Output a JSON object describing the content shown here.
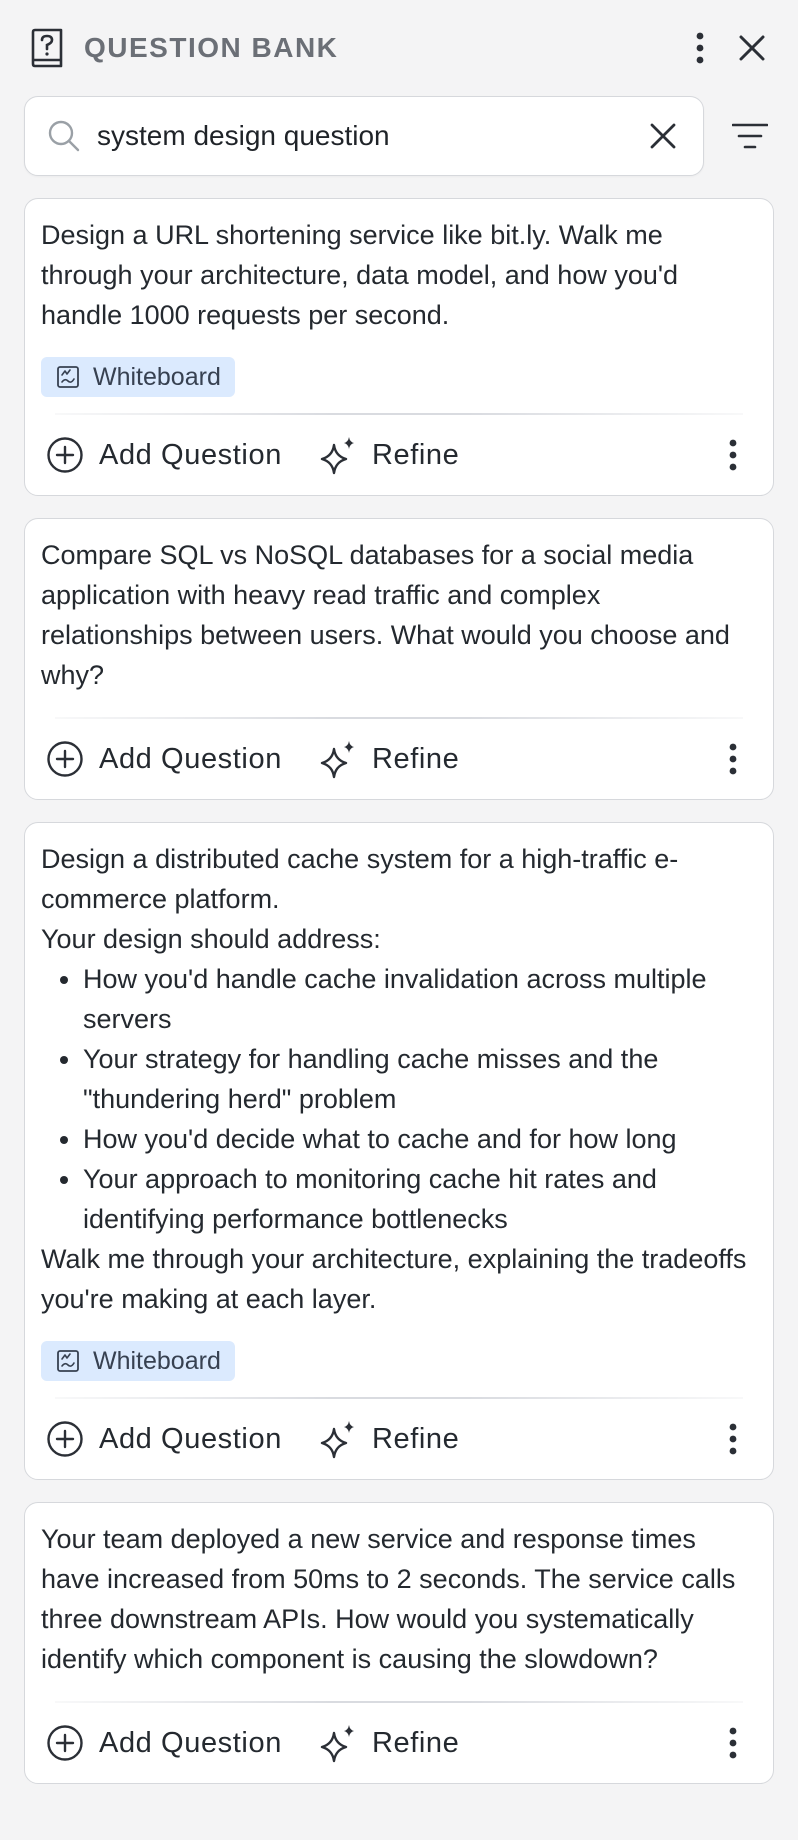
{
  "header": {
    "title": "QUESTION BANK"
  },
  "search": {
    "value": "system design question"
  },
  "cards": [
    {
      "intro": "Design a URL shortening service like bit.ly. Walk me through your architecture, data model, and how you'd handle 1000 requests per second.",
      "bullets": [],
      "outro": "",
      "tag": "Whiteboard",
      "add_label": "Add Question",
      "refine_label": "Refine"
    },
    {
      "intro": "Compare SQL vs NoSQL databases for a social media application with heavy read traffic and complex relationships between users. What would you choose and why?",
      "bullets": [],
      "outro": "",
      "tag": "",
      "add_label": "Add Question",
      "refine_label": "Refine"
    },
    {
      "intro": "Design a distributed cache system for a high-traffic e-commerce platform.",
      "intro2": "Your design should address:",
      "bullets": [
        "How you'd handle cache invalidation across multiple servers",
        "Your strategy for handling cache misses and the \"thundering herd\" problem",
        "How you'd decide what to cache and for how long",
        "Your approach to monitoring cache hit rates and identifying performance bottlenecks"
      ],
      "outro": "Walk me through your architecture, explaining the tradeoffs you're making at each layer.",
      "tag": "Whiteboard",
      "add_label": "Add Question",
      "refine_label": "Refine"
    },
    {
      "intro": "Your team deployed a new service and response times have increased from 50ms to 2 seconds. The service calls three downstream APIs. How would you systematically identify which component is causing the slowdown?",
      "bullets": [],
      "outro": "",
      "tag": "",
      "add_label": "Add Question",
      "refine_label": "Refine"
    }
  ],
  "icons": {
    "header": "question-book-icon",
    "menu": "kebab-menu-icon",
    "close": "close-icon",
    "search": "search-icon",
    "clear": "clear-icon",
    "filter": "filter-icon",
    "tag": "whiteboard-icon",
    "add": "plus-circle-icon",
    "refine": "sparkle-icon",
    "more": "more-vertical-icon"
  },
  "colors": {
    "tag_bg": "#dbeafe",
    "title": "#6b6f76",
    "background": "#f4f4f5"
  }
}
